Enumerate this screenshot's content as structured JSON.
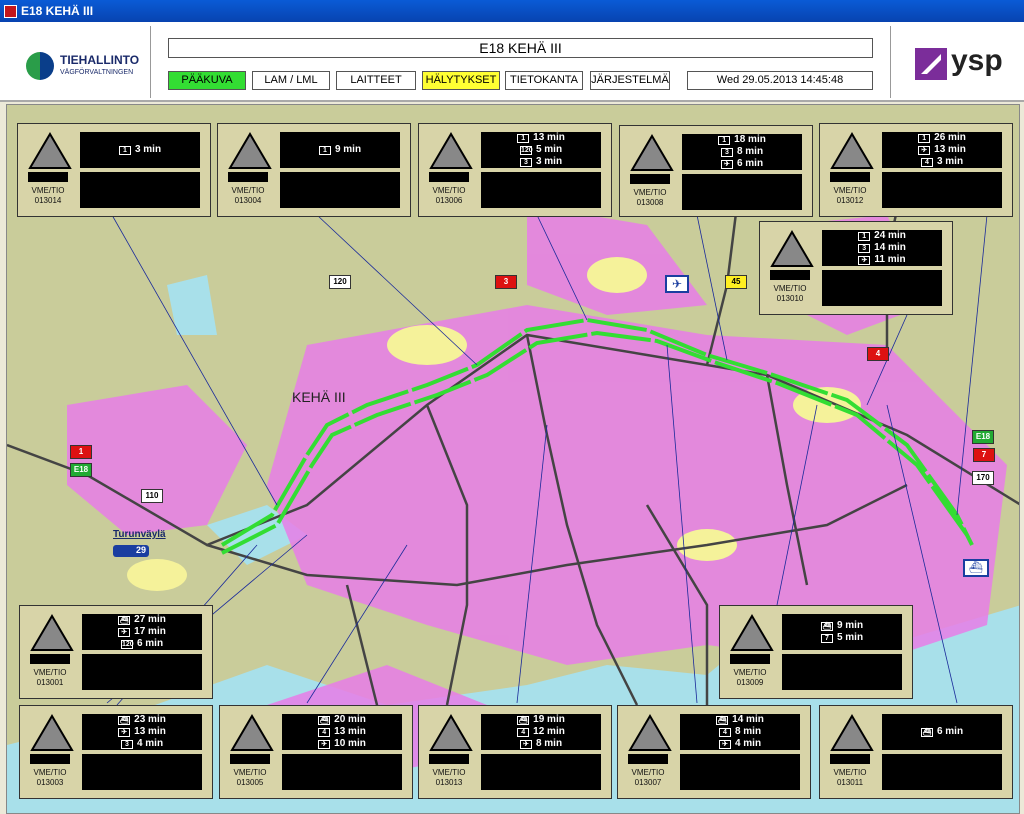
{
  "window": {
    "title": "E18 KEHÄ III"
  },
  "header": {
    "logo_line1": "TIEHALLINTO",
    "logo_line2": "VÄGFÖRVALTNINGEN",
    "title": "E18 KEHÄ III",
    "datetime": "Wed 29.05.2013 14:45:48",
    "brand": "ysp"
  },
  "nav": [
    {
      "label": "PÄÄKUVA",
      "color": "#33dd33"
    },
    {
      "label": "LAM / LML",
      "color": "#ffffff"
    },
    {
      "label": "LAITTEET",
      "color": "#ffffff"
    },
    {
      "label": "HÄLYTYKSET",
      "color": "#ffff33"
    },
    {
      "label": "TIETOKANTA",
      "color": "#ffffff"
    },
    {
      "label": "JÄRJESTELMÄ",
      "color": "#ffffff"
    }
  ],
  "map": {
    "label_kehaiii": "KEHÄ III",
    "label_turunvayla": "Turunväylä",
    "badge_29": "29",
    "road_labels": [
      "120",
      "3",
      "45",
      "4",
      "1",
      "E18",
      "110",
      "E18",
      "7",
      "170"
    ],
    "route_color": "#33dd33"
  },
  "signs": [
    {
      "id": "013014",
      "device": "VME/TIO",
      "times": [
        [
          "1",
          "3 min"
        ]
      ]
    },
    {
      "id": "013004",
      "device": "VME/TIO",
      "times": [
        [
          "1",
          "9 min"
        ]
      ]
    },
    {
      "id": "013006",
      "device": "VME/TIO",
      "times": [
        [
          "1",
          "13 min"
        ],
        [
          "120",
          "5 min"
        ],
        [
          "3",
          "3 min"
        ]
      ]
    },
    {
      "id": "013008",
      "device": "VME/TIO",
      "times": [
        [
          "1",
          "18 min"
        ],
        [
          "3",
          "8 min"
        ],
        [
          "plane",
          "6 min"
        ]
      ]
    },
    {
      "id": "013012",
      "device": "VME/TIO",
      "times": [
        [
          "1",
          "26 min"
        ],
        [
          "plane",
          "13 min"
        ],
        [
          "4",
          "3 min"
        ]
      ]
    },
    {
      "id": "013010",
      "device": "VME/TIO",
      "times": [
        [
          "1",
          "24 min"
        ],
        [
          "3",
          "14 min"
        ],
        [
          "plane",
          "11 min"
        ]
      ]
    },
    {
      "id": "013001",
      "device": "VME/TIO",
      "times": [
        [
          "ship",
          "27 min"
        ],
        [
          "plane",
          "17 min"
        ],
        [
          "120",
          "6 min"
        ]
      ]
    },
    {
      "id": "013009",
      "device": "VME/TIO",
      "times": [
        [
          "ship",
          "9 min"
        ],
        [
          "7",
          "5 min"
        ]
      ]
    },
    {
      "id": "013003",
      "device": "VME/TIO",
      "times": [
        [
          "ship",
          "23 min"
        ],
        [
          "plane",
          "13 min"
        ],
        [
          "3",
          "4 min"
        ]
      ]
    },
    {
      "id": "013005",
      "device": "VME/TIO",
      "times": [
        [
          "ship",
          "20 min"
        ],
        [
          "4",
          "13 min"
        ],
        [
          "plane",
          "10 min"
        ]
      ]
    },
    {
      "id": "013013",
      "device": "VME/TIO",
      "times": [
        [
          "ship",
          "19 min"
        ],
        [
          "4",
          "12 min"
        ],
        [
          "plane",
          "8 min"
        ]
      ]
    },
    {
      "id": "013007",
      "device": "VME/TIO",
      "times": [
        [
          "ship",
          "14 min"
        ],
        [
          "4",
          "8 min"
        ],
        [
          "plane",
          "4 min"
        ]
      ]
    },
    {
      "id": "013011",
      "device": "VME/TIO",
      "times": [
        [
          "ship",
          "6 min"
        ]
      ]
    }
  ]
}
